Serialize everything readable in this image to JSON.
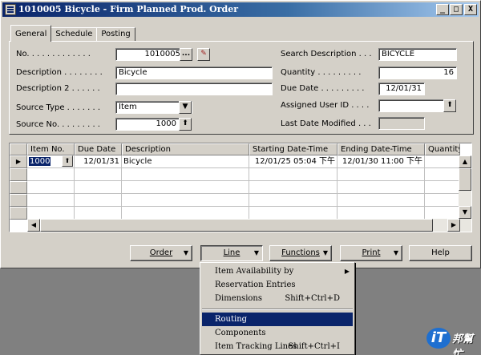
{
  "window": {
    "title": "1010005 Bicycle - Firm Planned Prod. Order",
    "controls": {
      "minimize": "_",
      "maximize": "□",
      "close": "X"
    }
  },
  "tabs": [
    "General",
    "Schedule",
    "Posting"
  ],
  "general": {
    "no_label": "No. . . . . . . . . . . . .",
    "no_value": "1010005",
    "description_label": "Description . . . . . . . .",
    "description_value": "Bicycle",
    "description2_label": "Description 2 . . . . . .",
    "description2_value": "",
    "source_type_label": "Source Type . . . . . . .",
    "source_type_value": "Item",
    "source_no_label": "Source No. . . . . . . . .",
    "source_no_value": "1000",
    "search_description_label": "Search Description . . .",
    "search_description_value": "BICYCLE",
    "quantity_label": "Quantity . . . . . . . . .",
    "quantity_value": "16",
    "due_date_label": "Due Date . . . . . . . . .",
    "due_date_value": "12/01/31",
    "assigned_user_label": "Assigned User ID . . . .",
    "assigned_user_value": "",
    "last_modified_label": "Last Date Modified . . .",
    "last_modified_value": ""
  },
  "lines": {
    "columns": [
      "Item No.",
      "Due Date",
      "Description",
      "Starting Date-Time",
      "Ending Date-Time",
      "Quantity"
    ],
    "rows": [
      {
        "item_no": "1000",
        "due_date": "12/01/31",
        "description": "Bicycle",
        "starting": "12/01/25 05:04 下午",
        "ending": "12/01/30 11:00 下午",
        "quantity": ""
      }
    ]
  },
  "buttons": {
    "order": "Order",
    "line": "Line",
    "functions": "Functions",
    "print": "Print",
    "help": "Help"
  },
  "line_menu": {
    "items": [
      {
        "label": "Item Availability by",
        "shortcut": "",
        "submenu": true
      },
      {
        "label": "Reservation Entries",
        "shortcut": ""
      },
      {
        "label": "Dimensions",
        "shortcut": "Shift+Ctrl+D"
      },
      {
        "label": "Routing",
        "shortcut": "",
        "highlighted": true
      },
      {
        "label": "Components",
        "shortcut": ""
      },
      {
        "label": "Item Tracking Lines",
        "shortcut": "Shift+Ctrl+I"
      }
    ]
  },
  "colors": {
    "title_active": "#0a246a",
    "face": "#d4d0c8",
    "desktop": "#808080",
    "highlight": "#0a246a"
  }
}
